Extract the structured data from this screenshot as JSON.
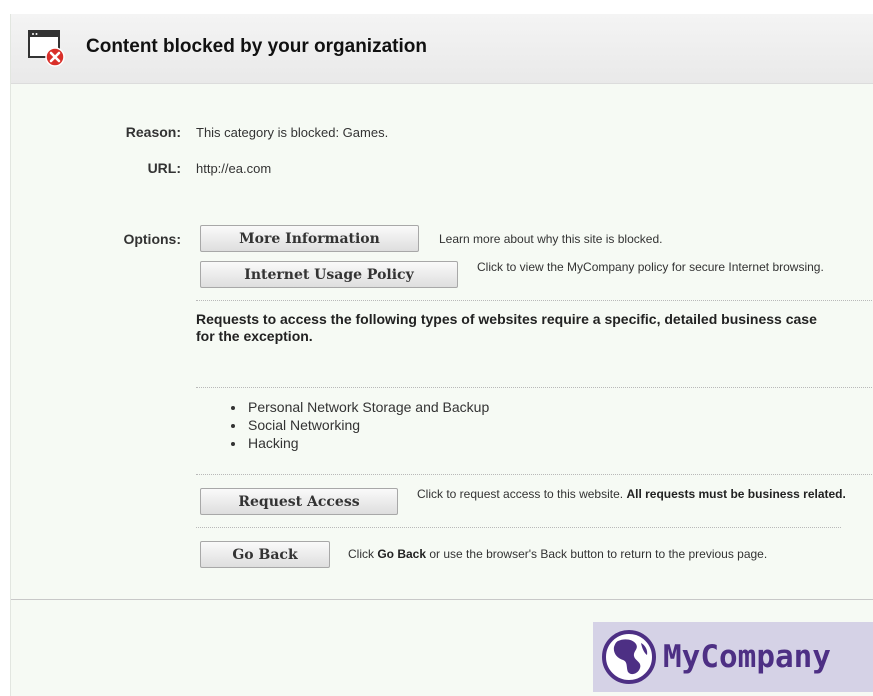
{
  "header": {
    "title": "Content blocked by your organization",
    "icon": "blocked-window-icon"
  },
  "details": {
    "reason_label": "Reason:",
    "reason_value": "This category is blocked: Games.",
    "url_label": "URL:",
    "url_value": "http://ea.com"
  },
  "options": {
    "label": "Options:",
    "more_info_button": "More Information",
    "more_info_desc": "Learn more about why this site is blocked.",
    "policy_button": "Internet Usage Policy",
    "policy_desc": "Click to view the MyCompany policy for secure Internet browsing."
  },
  "notice": {
    "text": "Requests to access the following types of websites require a specific, detailed business case for the exception.",
    "items": [
      "Personal Network Storage and Backup",
      "Social Networking",
      "Hacking"
    ]
  },
  "request": {
    "button": "Request Access",
    "desc_prefix": "Click to request access to this website.",
    "desc_bold": "All requests must be business related."
  },
  "goback": {
    "button": "Go Back",
    "desc_prefix": "Click",
    "desc_bold": "Go Back",
    "desc_suffix": "or use the browser's Back button to return to the previous page."
  },
  "brand": {
    "name": "MyCompany",
    "logo": "globe-logo-icon",
    "color": "#4d2f84",
    "background": "#d5d2e6"
  },
  "colors": {
    "error_red": "#d9302a",
    "page_background": "#f6faf4"
  }
}
